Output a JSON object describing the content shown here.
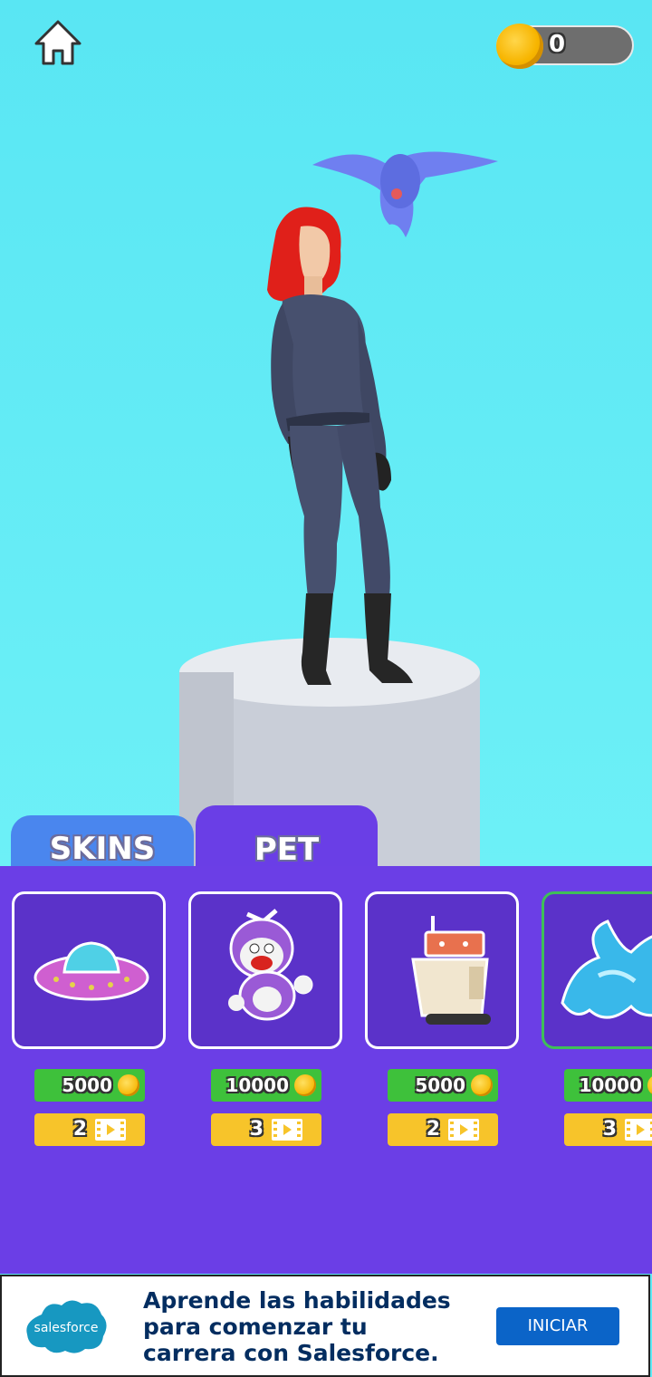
{
  "hud": {
    "home_icon": "home-icon",
    "coins": "0",
    "coin_icon": "coin-icon"
  },
  "tabs": [
    {
      "label": "SKINS",
      "active": false
    },
    {
      "label": "PET",
      "active": true
    }
  ],
  "pets": [
    {
      "name_icon": "ufo-pet-icon",
      "price": "5000",
      "ads": "2",
      "selected": false
    },
    {
      "name_icon": "propeller-cat-pet-icon",
      "price": "10000",
      "ads": "3",
      "selected": false
    },
    {
      "name_icon": "robot-pet-icon",
      "price": "5000",
      "ads": "2",
      "selected": false
    },
    {
      "name_icon": "ice-dragon-pet-icon",
      "price": "10000",
      "ads": "3",
      "selected": true
    }
  ],
  "banner": {
    "logo_text": "salesforce",
    "headline": "Aprende las habilidades\npara comenzar tu\ncarrera con Salesforce.",
    "cta": "INICIAR"
  },
  "colors": {
    "sky": "#5fe9f4",
    "panel": "#6b3ee6",
    "price_green": "#3ec13b",
    "ad_yellow": "#f7c42a",
    "tab_skins": "#4a86ee"
  }
}
